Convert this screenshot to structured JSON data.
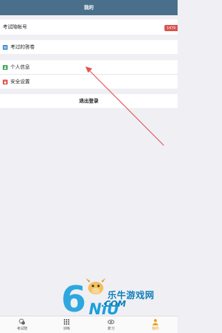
{
  "header": {
    "title": "我的"
  },
  "account": {
    "label": "考试陪帐号",
    "badge": "1479"
  },
  "menu": {
    "exams_label": "考过的答卷",
    "profile_label": "个人信息",
    "security_label": "安全设置"
  },
  "logout": {
    "label": "退出登录"
  },
  "tabbar": {
    "tabs": [
      {
        "label": "考试陪",
        "icon": "chat-icon"
      },
      {
        "label": "训练",
        "icon": "grid-icon"
      },
      {
        "label": "复习",
        "icon": "eye-icon"
      },
      {
        "label": "我的",
        "icon": "user-icon"
      }
    ]
  },
  "watermark": {
    "text": "乐牛游戏网",
    "logo": "6NiU.COM"
  },
  "colors": {
    "header": "#4a6f8a",
    "exams_icon": "#3a8fd6",
    "profile_icon": "#3aa655",
    "security_icon": "#d9534f",
    "badge": "#d9534f",
    "active_tab": "#f0a020",
    "arrow": "#e05555"
  }
}
